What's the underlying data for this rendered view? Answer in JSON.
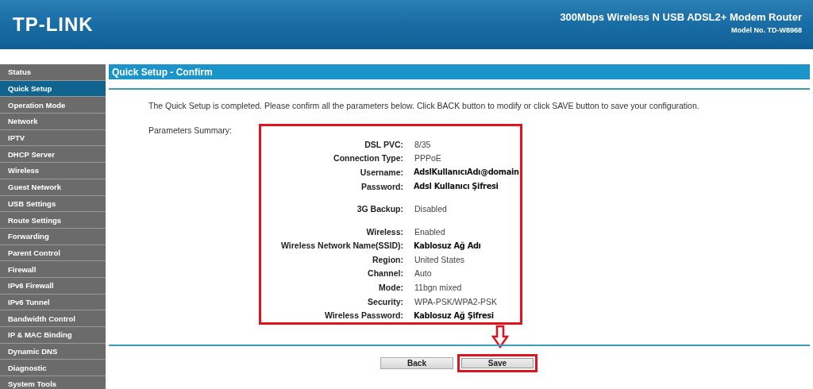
{
  "header": {
    "logo": "TP-LINK",
    "product": "300Mbps Wireless N USB ADSL2+ Modem Router",
    "model": "Model No. TD-W8968"
  },
  "sidebar": {
    "items": [
      {
        "label": "Status",
        "selected": false
      },
      {
        "label": "Quick Setup",
        "selected": true
      },
      {
        "label": "Operation Mode",
        "selected": false
      },
      {
        "label": "Network",
        "selected": false
      },
      {
        "label": "IPTV",
        "selected": false
      },
      {
        "label": "DHCP Server",
        "selected": false
      },
      {
        "label": "Wireless",
        "selected": false
      },
      {
        "label": "Guest Network",
        "selected": false
      },
      {
        "label": "USB Settings",
        "selected": false
      },
      {
        "label": "Route Settings",
        "selected": false
      },
      {
        "label": "Forwarding",
        "selected": false
      },
      {
        "label": "Parent Control",
        "selected": false
      },
      {
        "label": "Firewall",
        "selected": false
      },
      {
        "label": "IPv6 Firewall",
        "selected": false
      },
      {
        "label": "IPv6 Tunnel",
        "selected": false
      },
      {
        "label": "Bandwidth Control",
        "selected": false
      },
      {
        "label": "IP & MAC Binding",
        "selected": false
      },
      {
        "label": "Dynamic DNS",
        "selected": false
      },
      {
        "label": "Diagnostic",
        "selected": false
      },
      {
        "label": "System Tools",
        "selected": false
      }
    ]
  },
  "content": {
    "title": "Quick Setup - Confirm",
    "description": "The Quick Setup is completed. Please confirm all the parameters below. Click BACK button to modify or click SAVE button to save your configuration.",
    "summary_label": "Parameters Summary:",
    "parameters": [
      {
        "label": "DSL PVC:",
        "value": "8/35",
        "kind": "plain",
        "gap_before": false
      },
      {
        "label": "Connection Type:",
        "value": "PPPoE",
        "kind": "plain",
        "gap_before": false
      },
      {
        "label": "Username:",
        "value": "AdslKullanıcıAdı@domain",
        "kind": "annotated",
        "gap_before": false
      },
      {
        "label": "Password:",
        "value": "Adsl Kullanıcı Şifresi",
        "kind": "annotated",
        "gap_before": false
      },
      {
        "label": "3G Backup:",
        "value": "Disabled",
        "kind": "plain",
        "gap_before": true
      },
      {
        "label": "Wireless:",
        "value": "Enabled",
        "kind": "plain",
        "gap_before": true
      },
      {
        "label": "Wireless Network Name(SSID):",
        "value": "Kablosuz Ağ Adı",
        "kind": "annotated",
        "gap_before": false
      },
      {
        "label": "Region:",
        "value": "United States",
        "kind": "plain",
        "gap_before": false
      },
      {
        "label": "Channel:",
        "value": "Auto",
        "kind": "plain",
        "gap_before": false
      },
      {
        "label": "Mode:",
        "value": "11bgn mixed",
        "kind": "plain",
        "gap_before": false
      },
      {
        "label": "Security:",
        "value": "WPA-PSK/WPA2-PSK",
        "kind": "plain",
        "gap_before": false
      },
      {
        "label": "Wireless Password:",
        "value": "Kablosuz Ağ Şifresi",
        "kind": "annotated",
        "gap_before": false
      }
    ],
    "buttons": [
      {
        "label": "Back",
        "highlighted": false
      },
      {
        "label": "Save",
        "highlighted": true
      }
    ]
  }
}
